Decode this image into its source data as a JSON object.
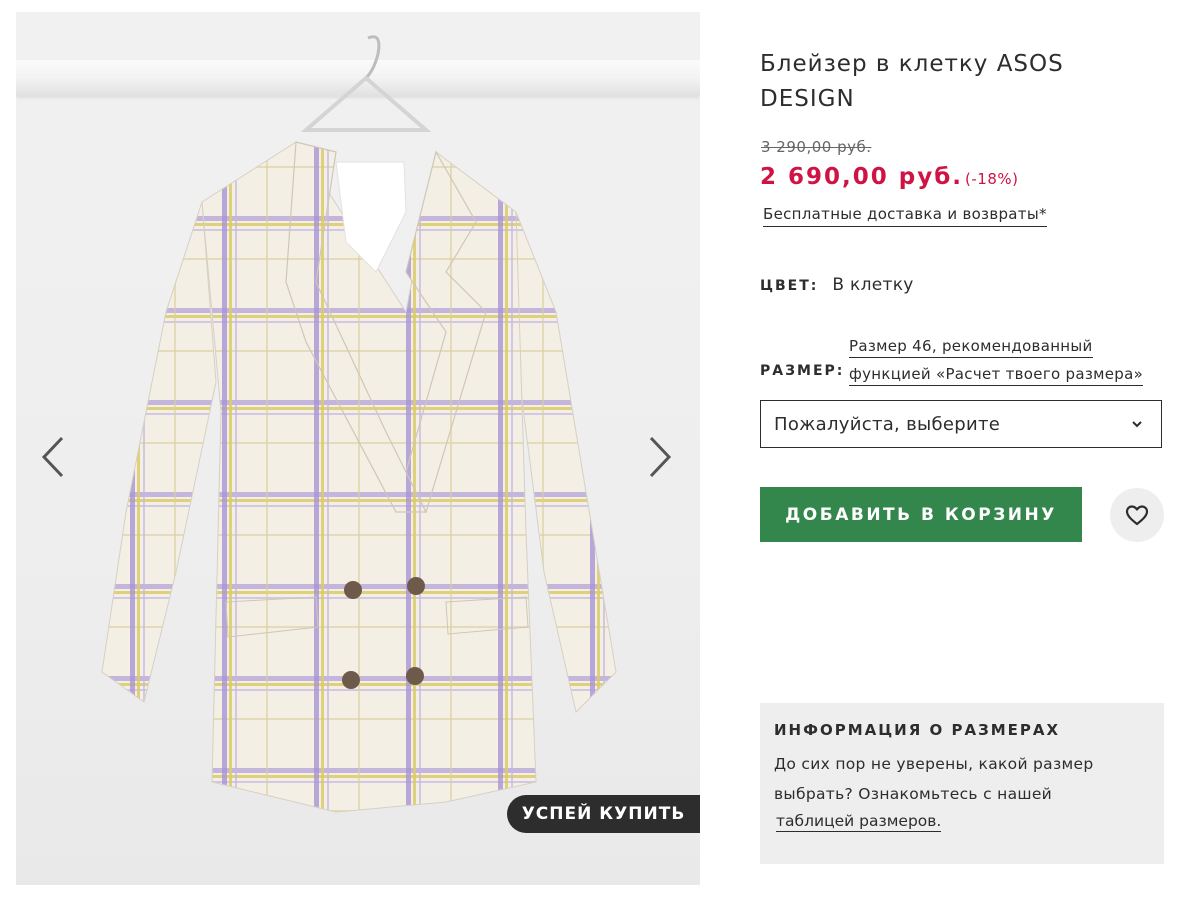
{
  "product": {
    "title": "Блейзер в клетку ASOS DESIGN",
    "old_price": "3 290,00 руб.",
    "price": "2 690,00 руб.",
    "discount": "(-18%)",
    "delivery_link": "Бесплатные доставка и возвраты*",
    "price_color": "#d01345"
  },
  "gallery": {
    "badge": "УСПЕЙ КУПИТЬ",
    "prev_icon": "chevron-left-icon",
    "next_icon": "chevron-right-icon"
  },
  "color": {
    "label": "ЦВЕТ:",
    "value": "В клетку"
  },
  "size": {
    "label": "РАЗМЕР:",
    "recommendation_line1": "Размер 46, рекомендованный",
    "recommendation_line2": "функцией «Расчет твоего размера»",
    "select_value": "Пожалуйста, выберите"
  },
  "actions": {
    "add_to_cart": "ДОБАВИТЬ В КОРЗИНУ",
    "add_to_cart_color": "#34874c",
    "save_icon": "heart-icon"
  },
  "size_info": {
    "heading": "ИНФОРМАЦИЯ О РАЗМЕРАХ",
    "text": "До сих пор не уверены, какой размер выбрать? Ознакомьтесь с нашей",
    "link": "таблицей размеров."
  }
}
